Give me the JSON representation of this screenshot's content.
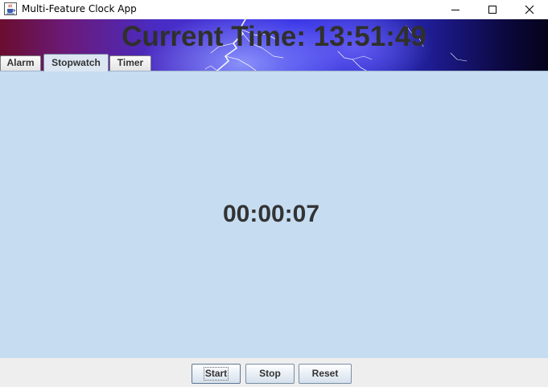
{
  "window": {
    "title": "Multi-Feature Clock App",
    "icon": "java-cup-icon",
    "controls": [
      "minimize-icon",
      "maximize-icon",
      "close-icon"
    ]
  },
  "banner": {
    "current_time": "Current Time: 13:51:49",
    "background": "lightning-storm"
  },
  "tabs": [
    {
      "label": "Alarm",
      "selected": false
    },
    {
      "label": "Stopwatch",
      "selected": true
    },
    {
      "label": "Timer",
      "selected": false
    }
  ],
  "stopwatch": {
    "elapsed": "00:00:07"
  },
  "buttons": {
    "start": "Start",
    "stop": "Stop",
    "reset": "Reset"
  },
  "colors": {
    "content_background": "#c6dcf1",
    "text": "#333333",
    "button_bar": "#eeeeee"
  }
}
